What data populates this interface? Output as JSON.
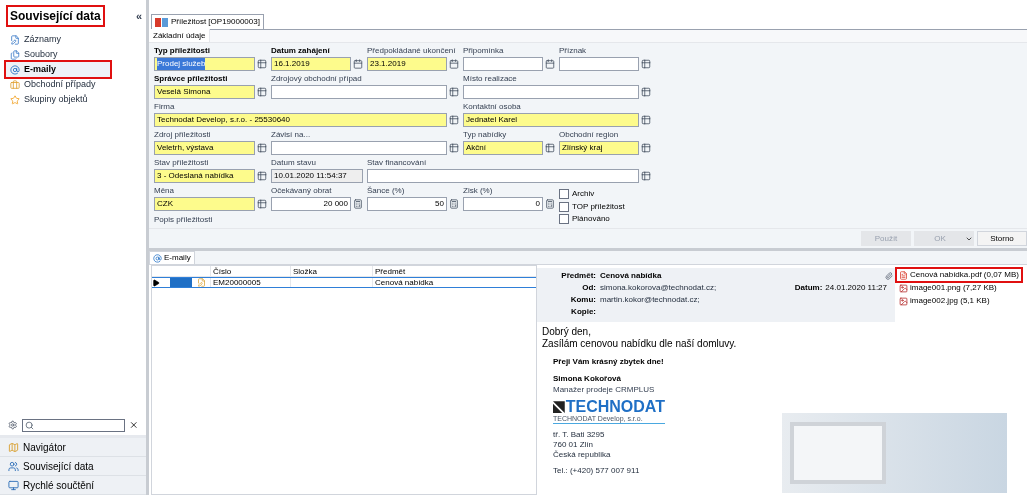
{
  "sidebar": {
    "title": "Související data",
    "title_highlighted": true,
    "collapse": "«",
    "items": [
      {
        "label": "Záznamy",
        "selected": false,
        "highlighted": false
      },
      {
        "label": "Soubory",
        "selected": false,
        "highlighted": false
      },
      {
        "label": "E-maily",
        "selected": true,
        "highlighted": true
      },
      {
        "label": "Obchodní případy",
        "selected": false,
        "highlighted": false
      },
      {
        "label": "Skupiny objektů",
        "selected": false,
        "highlighted": false
      }
    ],
    "bottom_nav": [
      {
        "label": "Navigátor"
      },
      {
        "label": "Související data"
      },
      {
        "label": "Rychlé součtění"
      }
    ]
  },
  "document_tab": {
    "title": "Příležitost [OP19000003]"
  },
  "subtab": {
    "label": "Základní údaje"
  },
  "form": [
    {
      "label": "Typ příležitosti",
      "bold": true,
      "value": "Prodej služeb",
      "required": true,
      "kind": "lookup",
      "value_selected": true
    },
    {
      "label": "Datum zahájení",
      "bold": true,
      "value": "16.1.2019",
      "required": true,
      "kind": "date"
    },
    {
      "label": "Předpokládané ukončení",
      "bold": false,
      "value": "23.1.2019",
      "required": true,
      "kind": "date"
    },
    {
      "label": "Připomínka",
      "bold": false,
      "required": false,
      "kind": "date"
    },
    {
      "label": "Příznak",
      "bold": false,
      "required": false,
      "kind": "lookup"
    },
    {
      "label": "Správce příležitosti",
      "bold": true,
      "value": "Veselá Simona",
      "required": true,
      "kind": "lookup"
    },
    {
      "label": "Zdrojový obchodní případ",
      "bold": false,
      "required": false,
      "kind": "lookup"
    },
    {
      "label": "Místo realizace",
      "bold": false,
      "required": false,
      "kind": "lookup"
    },
    {
      "label": "Firma",
      "bold": false,
      "value": "Technodat Develop, s.r.o. - 25530640",
      "required": true,
      "kind": "lookup"
    },
    {
      "label": "Kontaktní osoba",
      "bold": false,
      "value": "Jednatel Karel",
      "required": true,
      "kind": "lookup"
    },
    {
      "label": "Zdroj příležitosti",
      "bold": false,
      "value": "Veletrh, výstava",
      "required": true,
      "kind": "lookup"
    },
    {
      "label": "Závisí na...",
      "bold": false,
      "required": false,
      "kind": "lookup"
    },
    {
      "label": "Typ nabídky",
      "bold": false,
      "value": "Akční",
      "required": true,
      "kind": "lookup"
    },
    {
      "label": "Obchodní region",
      "bold": false,
      "value": "Zlínský kraj",
      "required": true,
      "kind": "lookup"
    },
    {
      "label": "Stav příležitosti",
      "bold": false,
      "value": "3 - Odeslaná nabídka",
      "required": true,
      "kind": "lookup"
    },
    {
      "label": "Datum stavu",
      "bold": false,
      "value": "10.01.2020 11:54:37",
      "required": false,
      "kind": "readonly"
    },
    {
      "label": "Stav financování",
      "bold": false,
      "required": false,
      "kind": "lookup"
    },
    {
      "label": "Měna",
      "bold": false,
      "value": "CZK",
      "required": true,
      "kind": "lookup"
    },
    {
      "label": "Očekávaný obrat",
      "bold": false,
      "value": "20 000",
      "required": false,
      "kind": "number"
    },
    {
      "label": "Šance (%)",
      "bold": false,
      "value": "50",
      "required": false,
      "kind": "number"
    },
    {
      "label": "Zisk (%)",
      "bold": false,
      "value": "0",
      "required": false,
      "kind": "number"
    },
    {
      "kind": "checkboxes",
      "items": [
        {
          "label": "Archiv",
          "checked": false
        },
        {
          "label": "TOP příležitost",
          "checked": false
        }
      ]
    },
    {
      "label": "Popis příležitosti",
      "kind": "label"
    },
    {
      "kind": "checkboxes",
      "items": [
        {
          "label": "Plánováno",
          "checked": false
        }
      ]
    }
  ],
  "buttons": [
    {
      "label": "Použít",
      "disabled": true,
      "dropdown": false
    },
    {
      "label": "OK",
      "disabled": true,
      "dropdown": true
    },
    {
      "label": "Storno",
      "disabled": false,
      "dropdown": false
    }
  ],
  "emails_tab": {
    "label": "E-maily"
  },
  "email_table": {
    "columns": [
      "Číslo",
      "Složka",
      "Předmět"
    ],
    "rows": [
      {
        "cells": [
          "EM20000005",
          null,
          "Cenová nabídka"
        ],
        "selected": true
      }
    ]
  },
  "preview": {
    "fields": [
      {
        "label": "Předmět:",
        "value": "Cenová nabídka",
        "bold": true
      },
      {
        "label": "Od:",
        "value": "simona.kokorova@technodat.cz;",
        "bold": false
      },
      {
        "label": "Komu:",
        "value": "martin.kokor@technodat.cz;",
        "bold": false
      },
      {
        "label": "Kopie:"
      }
    ],
    "date_label": "Datum:",
    "date": "24.01.2020 11:27",
    "attachments": [
      {
        "name": "Cenová nabídka.pdf (0,07 MB)",
        "kind": "pdf",
        "highlighted": true
      },
      {
        "name": "image001.png (7,27 KB)",
        "kind": "image",
        "highlighted": false
      },
      {
        "name": "image002.jpg (5,1 KB)",
        "kind": "image",
        "highlighted": false
      }
    ],
    "body": [
      "Dobrý den,",
      "Zasílám cenovou nabídku dle naší domluvy."
    ],
    "signature": {
      "greeting": "Přeji Vám krásný zbytek dne!",
      "name": "Simona Kokořová",
      "role": "Manažer prodeje CRMPLUS",
      "logo": "TECHNODAT",
      "logo_sub": "TECHNODAT Develop, s.r.o.",
      "address": [
        "tř. T. Bati 3295",
        "760 01 Zlín",
        "Česká republika"
      ],
      "phone": "Tel.: (+420) 577 007 911"
    }
  }
}
